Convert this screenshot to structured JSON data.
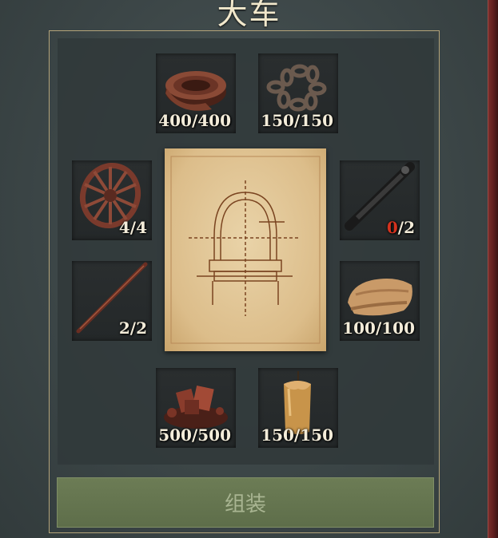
{
  "title": "大车",
  "materials": {
    "leather": {
      "have": "400",
      "need": "400"
    },
    "chain": {
      "have": "150",
      "need": "150"
    },
    "wheel": {
      "have": "4",
      "need": "4"
    },
    "roller": {
      "have": "0",
      "need": "2"
    },
    "rod": {
      "have": "2",
      "need": "2"
    },
    "cloth": {
      "have": "100",
      "need": "100"
    },
    "ore": {
      "have": "500",
      "need": "500"
    },
    "candle": {
      "have": "150",
      "need": "150"
    }
  },
  "assemble_button": "组装",
  "colors": {
    "shortage": "#d4321e",
    "button": "#647452",
    "frame": "#b4a47a"
  }
}
